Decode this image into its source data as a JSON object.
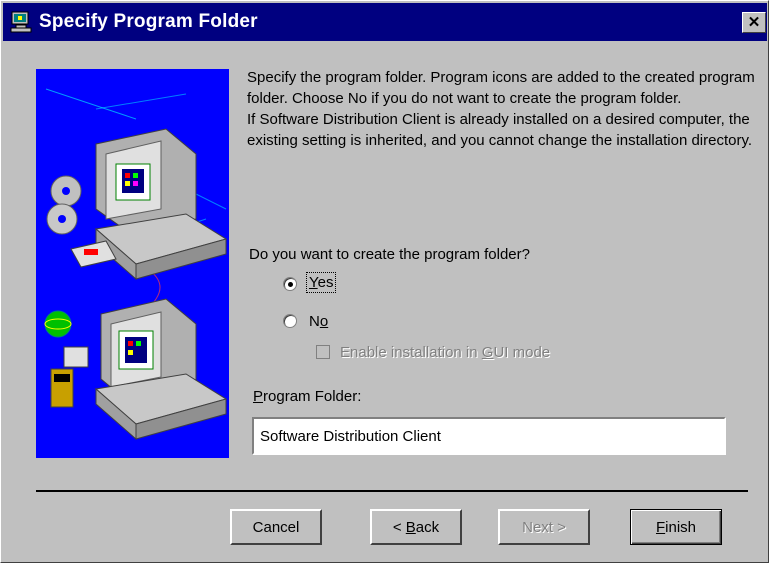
{
  "window": {
    "title": "Specify Program Folder",
    "title_bar_color": "#000080",
    "close_glyph": "✕"
  },
  "description": {
    "line1": "Specify the program folder.  Program icons are added to the created program folder. Choose No if you do not want to create the program folder.",
    "line2": "If Software Distribution Client is already installed on a desired computer, the existing setting is inherited, and you cannot change the installation directory."
  },
  "question": "Do you want to create the program folder?",
  "options": {
    "yes": {
      "pre": "",
      "accel": "Y",
      "post": "es",
      "selected": true
    },
    "no": {
      "pre": "N",
      "accel": "o",
      "post": "",
      "selected": false
    }
  },
  "checkbox": {
    "pre": "Enable installation in ",
    "accel": "G",
    "post": "UI mode",
    "checked": false,
    "enabled": false
  },
  "folder": {
    "label_accel": "P",
    "label_rest": "rogram Folder:",
    "value": "Software Distribution Client"
  },
  "buttons": {
    "cancel": "Cancel",
    "back_pre": "< ",
    "back_accel": "B",
    "back_post": "ack",
    "next": "Next >",
    "finish_accel": "F",
    "finish_post": "inish"
  },
  "art_color": "#0000ff"
}
